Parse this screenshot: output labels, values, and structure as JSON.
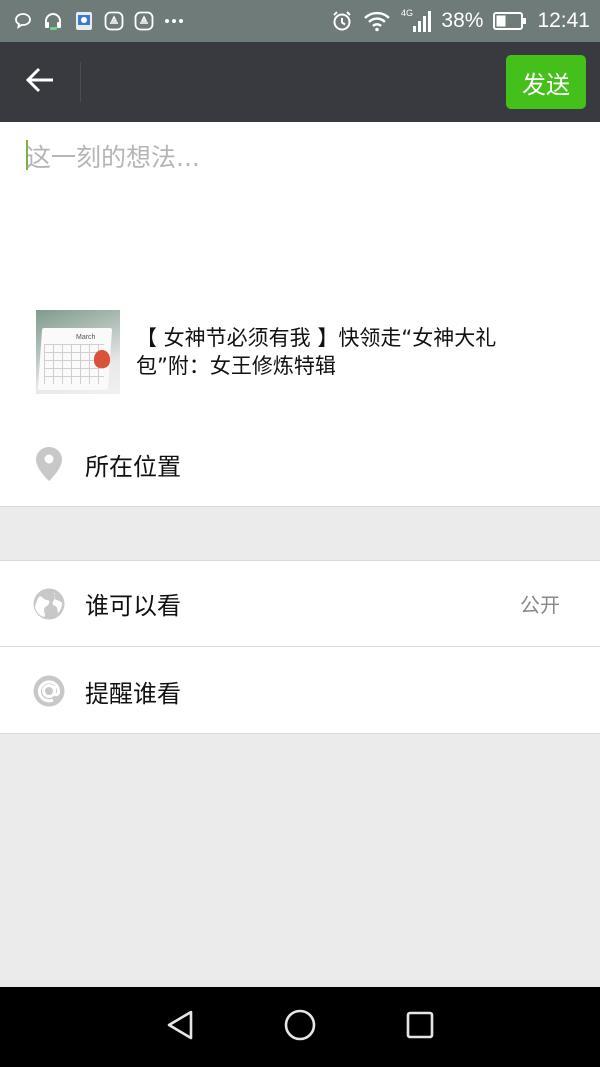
{
  "status_bar": {
    "battery_percent": "38%",
    "time": "12:41",
    "network": "4G",
    "left_icons": [
      "chat-bubble-icon",
      "headset-icon",
      "app-icon",
      "huawei-app-icon",
      "huawei-app-icon-2",
      "more-dots-icon"
    ],
    "right_icons": [
      "alarm-icon",
      "wifi-icon",
      "signal-icon",
      "battery-icon"
    ]
  },
  "header": {
    "back_icon": "arrow-left-icon",
    "send_label": "发送",
    "send_color": "#45c01a",
    "background": "#393a3f"
  },
  "compose": {
    "placeholder": "这一刻的想法...",
    "value": ""
  },
  "shared_link": {
    "title": "【 女神节必须有我 】快领走“女神大礼包”附：女王修炼特辑",
    "thumbnail_text": "March"
  },
  "location": {
    "icon": "location-pin-icon",
    "label": "所在位置"
  },
  "visibility": {
    "icon": "globe-icon",
    "label": "谁可以看",
    "value": "公开"
  },
  "mention": {
    "icon": "at-sign-icon",
    "label": "提醒谁看"
  },
  "nav_bar": {
    "icons": [
      "back-triangle-icon",
      "home-circle-icon",
      "recents-square-icon"
    ]
  }
}
